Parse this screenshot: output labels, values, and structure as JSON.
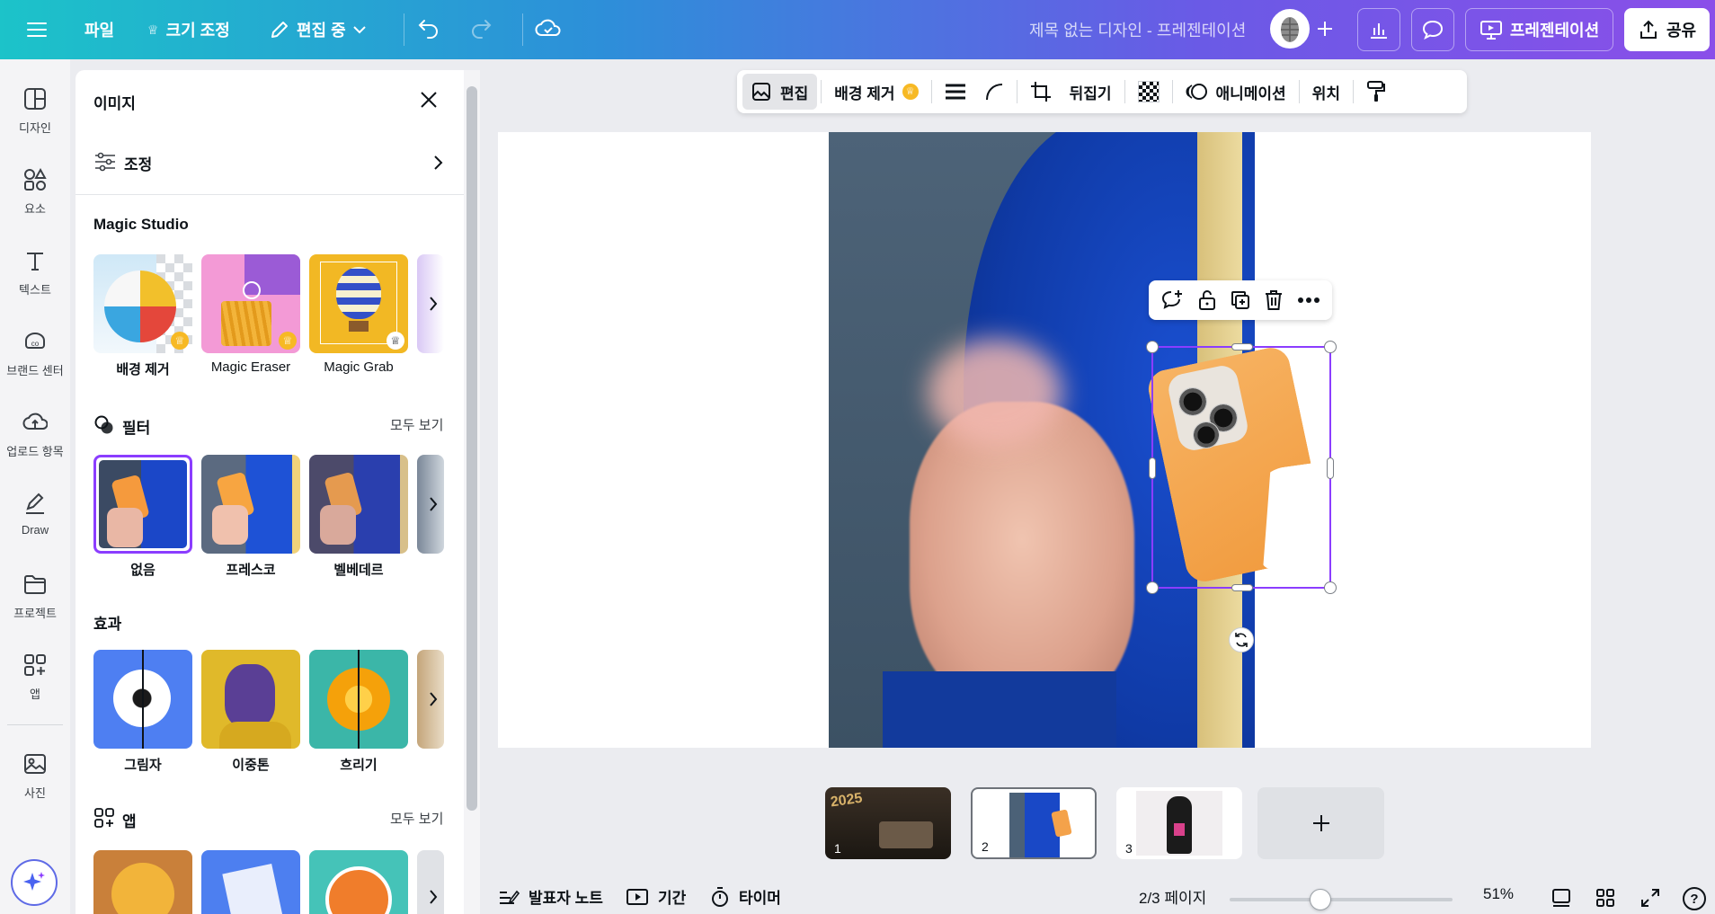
{
  "topbar": {
    "file": "파일",
    "resize": "크기 조정",
    "editing": "편집 중",
    "doc_title": "제목 없는 디자인 - 프레젠테이션",
    "present": "프레젠테이션",
    "share": "공유"
  },
  "rail": {
    "items": [
      {
        "label": "디자인",
        "icon": "design-icon"
      },
      {
        "label": "요소",
        "icon": "elements-icon"
      },
      {
        "label": "텍스트",
        "icon": "text-icon"
      },
      {
        "label": "브랜드 센터",
        "icon": "brand-icon"
      },
      {
        "label": "업로드 항목",
        "icon": "upload-icon"
      },
      {
        "label": "Draw",
        "icon": "draw-icon"
      },
      {
        "label": "프로젝트",
        "icon": "folder-icon"
      },
      {
        "label": "앱",
        "icon": "apps-icon"
      },
      {
        "label": "사진",
        "icon": "photo-icon"
      }
    ]
  },
  "panel": {
    "title": "이미지",
    "adjust": "조정",
    "magic_studio": {
      "title": "Magic Studio",
      "items": [
        "배경 제거",
        "Magic Eraser",
        "Magic Grab"
      ]
    },
    "filters": {
      "title": "필터",
      "see_all": "모두 보기",
      "items": [
        "없음",
        "프레스코",
        "벨베데르"
      ]
    },
    "effects": {
      "title": "효과",
      "items": [
        "그림자",
        "이중톤",
        "흐리기"
      ]
    },
    "apps": {
      "title": "앱",
      "see_all": "모두 보기"
    }
  },
  "context_toolbar": {
    "edit": "편집",
    "bg_remove": "배경 제거",
    "flip": "뒤집기",
    "animation": "애니메이션",
    "position": "위치"
  },
  "pages": [
    {
      "num": "1"
    },
    {
      "num": "2"
    },
    {
      "num": "3"
    }
  ],
  "bottom": {
    "notes": "발표자 노트",
    "duration": "기간",
    "timer": "타이머",
    "page_indicator": "2/3 페이지",
    "zoom": "51%",
    "zoom_level": 0.51,
    "help": "?"
  },
  "colors": {
    "accent": "#8b3dff",
    "topbar_start": "#1cc3c9",
    "topbar_end": "#8a4fe9"
  }
}
